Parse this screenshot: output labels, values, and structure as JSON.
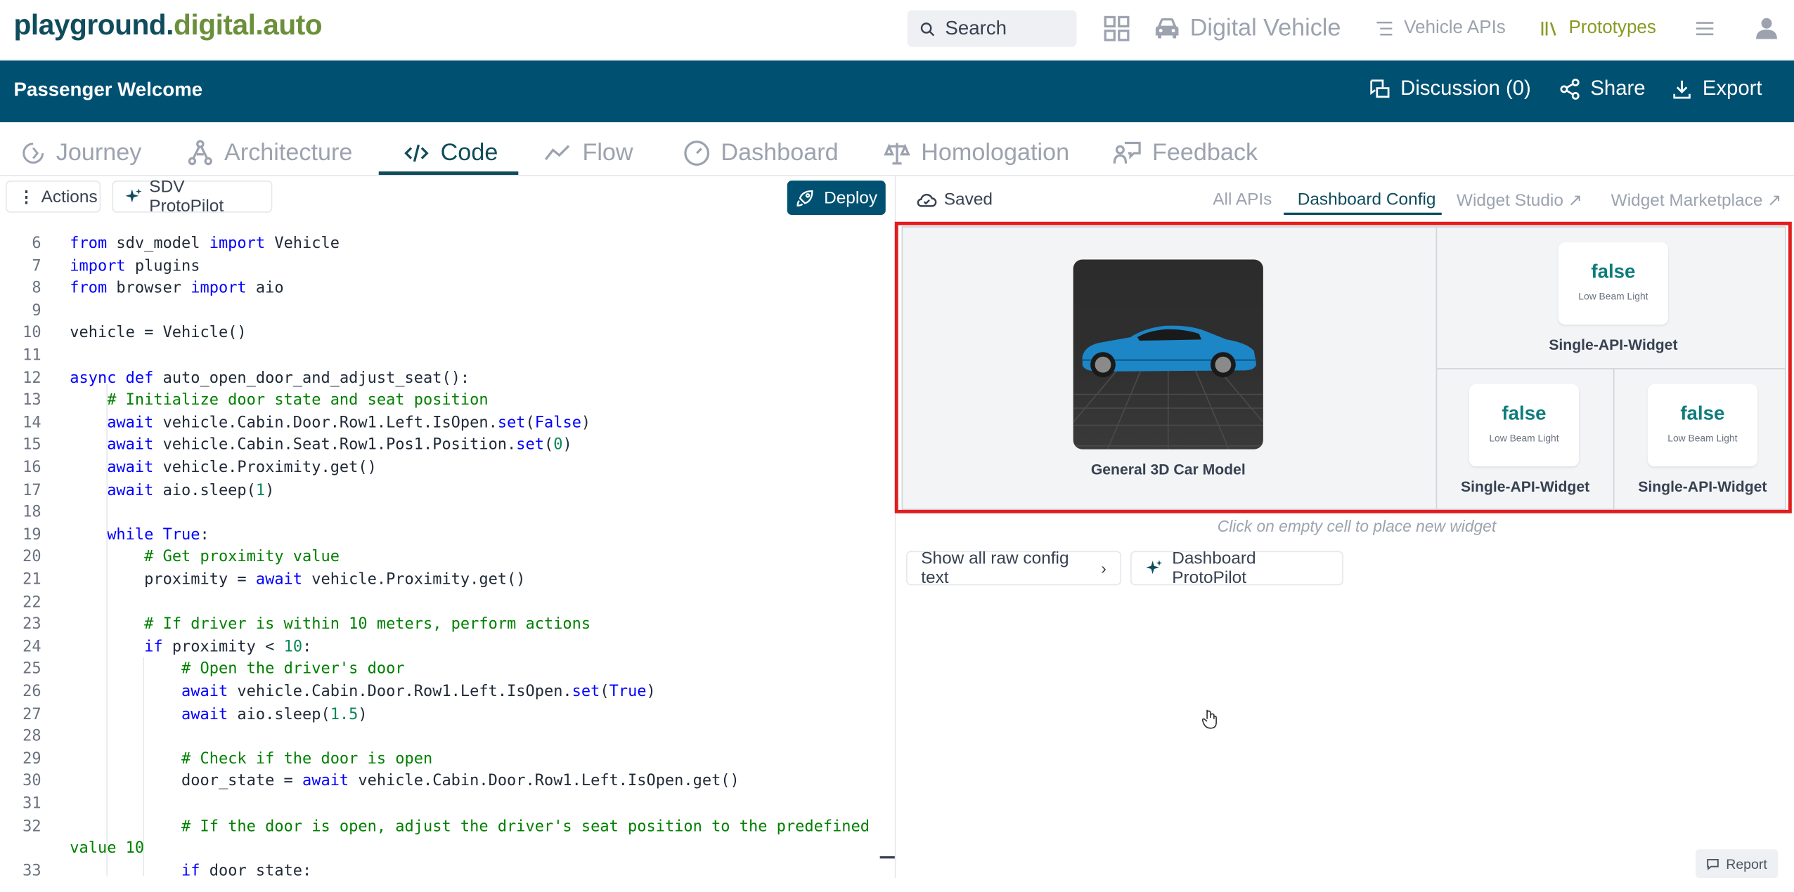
{
  "app": {
    "logo_part1": "playground.",
    "logo_part2": "digital.auto",
    "search_placeholder": "Search",
    "nav": {
      "digital_vehicle": "Digital Vehicle",
      "vehicle_apis": "Vehicle APIs",
      "prototypes": "Prototypes"
    }
  },
  "prototype": {
    "title": "Passenger Welcome",
    "discussion": "Discussion (0)",
    "share": "Share",
    "export": "Export"
  },
  "tabs": [
    "Journey",
    "Architecture",
    "Code",
    "Flow",
    "Dashboard",
    "Homologation",
    "Feedback"
  ],
  "active_tab": "Code",
  "editor": {
    "actions": "Actions",
    "protopilot": "SDV ProtoPilot",
    "deploy": "Deploy",
    "lines": [
      {
        "n": "6",
        "code": "from sdv_model import Vehicle"
      },
      {
        "n": "7",
        "code": "import plugins"
      },
      {
        "n": "8",
        "code": "from browser import aio"
      },
      {
        "n": "9",
        "code": ""
      },
      {
        "n": "10",
        "code": "vehicle = Vehicle()"
      },
      {
        "n": "11",
        "code": ""
      },
      {
        "n": "12",
        "code": "async def auto_open_door_and_adjust_seat():"
      },
      {
        "n": "13",
        "code": "    # Initialize door state and seat position"
      },
      {
        "n": "14",
        "code": "    await vehicle.Cabin.Door.Row1.Left.IsOpen.set(False)"
      },
      {
        "n": "15",
        "code": "    await vehicle.Cabin.Seat.Row1.Pos1.Position.set(0)"
      },
      {
        "n": "16",
        "code": "    await vehicle.Proximity.get()"
      },
      {
        "n": "17",
        "code": "    await aio.sleep(1)"
      },
      {
        "n": "18",
        "code": ""
      },
      {
        "n": "19",
        "code": "    while True:"
      },
      {
        "n": "20",
        "code": "        # Get proximity value"
      },
      {
        "n": "21",
        "code": "        proximity = await vehicle.Proximity.get()"
      },
      {
        "n": "22",
        "code": ""
      },
      {
        "n": "23",
        "code": "        # If driver is within 10 meters, perform actions"
      },
      {
        "n": "24",
        "code": "        if proximity < 10:"
      },
      {
        "n": "25",
        "code": "            # Open the driver's door"
      },
      {
        "n": "26",
        "code": "            await vehicle.Cabin.Door.Row1.Left.IsOpen.set(True)"
      },
      {
        "n": "27",
        "code": "            await aio.sleep(1.5)"
      },
      {
        "n": "28",
        "code": ""
      },
      {
        "n": "29",
        "code": "            # Check if the door is open"
      },
      {
        "n": "30",
        "code": "            door_state = await vehicle.Cabin.Door.Row1.Left.IsOpen.get()"
      },
      {
        "n": "31",
        "code": ""
      },
      {
        "n": "32",
        "code": "            # If the door is open, adjust the driver's seat position to the predefined"
      },
      {
        "n": "",
        "code": "value 10"
      },
      {
        "n": "33",
        "code": "            if door_state:"
      }
    ]
  },
  "dashboard": {
    "saved": "Saved",
    "tabs": {
      "all_apis": "All APIs",
      "dashboard_config": "Dashboard Config",
      "widget_studio": "Widget Studio",
      "widget_marketplace": "Widget Marketplace"
    },
    "car_caption": "General 3D Car Model",
    "widgets": [
      {
        "value": "false",
        "label": "Low Beam Light",
        "caption": "Single-API-Widget"
      },
      {
        "value": "false",
        "label": "Low Beam Light",
        "caption": "Single-API-Widget"
      },
      {
        "value": "false",
        "label": "Low Beam Light",
        "caption": "Single-API-Widget"
      }
    ],
    "hint": "Click on empty cell to place new widget",
    "show_raw": "Show all raw config text",
    "protopilot": "Dashboard ProtoPilot"
  },
  "report": "Report",
  "colors": {
    "brand_dark": "#005072",
    "accent_green": "#8a9a24",
    "highlight": "#e11d1d"
  }
}
